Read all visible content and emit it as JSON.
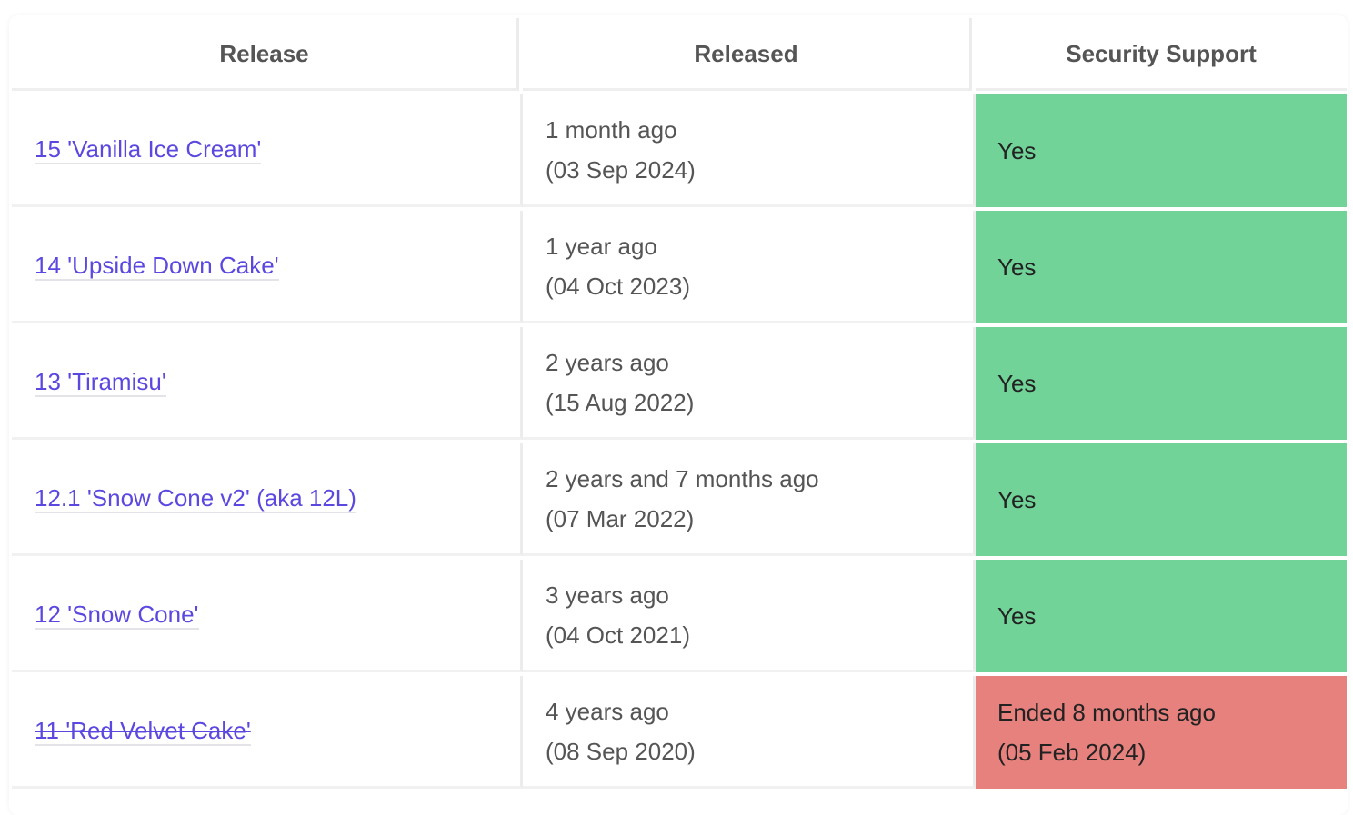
{
  "headers": [
    "Release",
    "Released",
    "Security Support"
  ],
  "rows": [
    {
      "release": "15 'Vanilla Ice Cream'",
      "released_rel": "1 month ago",
      "released_date": "(03 Sep 2024)",
      "support": "Yes",
      "support_date": "",
      "status": "yes"
    },
    {
      "release": "14 'Upside Down Cake'",
      "released_rel": "1 year ago",
      "released_date": "(04 Oct 2023)",
      "support": "Yes",
      "support_date": "",
      "status": "yes"
    },
    {
      "release": "13 'Tiramisu'",
      "released_rel": "2 years ago",
      "released_date": "(15 Aug 2022)",
      "support": "Yes",
      "support_date": "",
      "status": "yes"
    },
    {
      "release": "12.1 'Snow Cone v2' (aka 12L)",
      "released_rel": "2 years and 7 months ago",
      "released_date": "(07 Mar 2022)",
      "support": "Yes",
      "support_date": "",
      "status": "yes"
    },
    {
      "release": "12 'Snow Cone'",
      "released_rel": "3 years ago",
      "released_date": "(04 Oct 2021)",
      "support": "Yes",
      "support_date": "",
      "status": "yes"
    },
    {
      "release": "11 'Red Velvet Cake'",
      "released_rel": "4 years ago",
      "released_date": "(08 Sep 2020)",
      "support": "Ended 8 months ago",
      "support_date": "(05 Feb 2024)",
      "status": "no"
    }
  ],
  "colors": {
    "supported": "#71d398",
    "ended": "#e6817e",
    "link": "#5b48e0"
  }
}
